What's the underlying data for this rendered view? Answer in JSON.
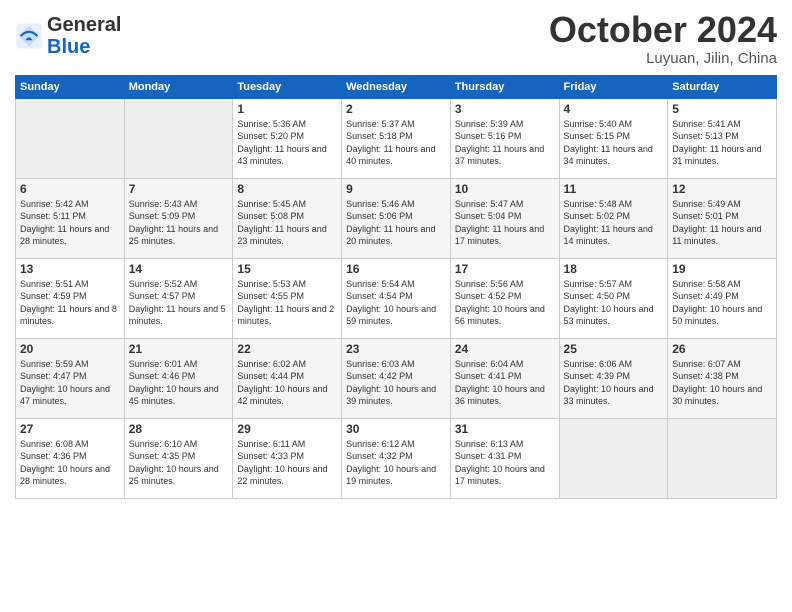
{
  "header": {
    "logo_general": "General",
    "logo_blue": "Blue",
    "month_title": "October 2024",
    "location": "Luyuan, Jilin, China"
  },
  "weekdays": [
    "Sunday",
    "Monday",
    "Tuesday",
    "Wednesday",
    "Thursday",
    "Friday",
    "Saturday"
  ],
  "weeks": [
    [
      {
        "day": "",
        "sunrise": "",
        "sunset": "",
        "daylight": ""
      },
      {
        "day": "",
        "sunrise": "",
        "sunset": "",
        "daylight": ""
      },
      {
        "day": "1",
        "sunrise": "Sunrise: 5:36 AM",
        "sunset": "Sunset: 5:20 PM",
        "daylight": "Daylight: 11 hours and 43 minutes."
      },
      {
        "day": "2",
        "sunrise": "Sunrise: 5:37 AM",
        "sunset": "Sunset: 5:18 PM",
        "daylight": "Daylight: 11 hours and 40 minutes."
      },
      {
        "day": "3",
        "sunrise": "Sunrise: 5:39 AM",
        "sunset": "Sunset: 5:16 PM",
        "daylight": "Daylight: 11 hours and 37 minutes."
      },
      {
        "day": "4",
        "sunrise": "Sunrise: 5:40 AM",
        "sunset": "Sunset: 5:15 PM",
        "daylight": "Daylight: 11 hours and 34 minutes."
      },
      {
        "day": "5",
        "sunrise": "Sunrise: 5:41 AM",
        "sunset": "Sunset: 5:13 PM",
        "daylight": "Daylight: 11 hours and 31 minutes."
      }
    ],
    [
      {
        "day": "6",
        "sunrise": "Sunrise: 5:42 AM",
        "sunset": "Sunset: 5:11 PM",
        "daylight": "Daylight: 11 hours and 28 minutes."
      },
      {
        "day": "7",
        "sunrise": "Sunrise: 5:43 AM",
        "sunset": "Sunset: 5:09 PM",
        "daylight": "Daylight: 11 hours and 25 minutes."
      },
      {
        "day": "8",
        "sunrise": "Sunrise: 5:45 AM",
        "sunset": "Sunset: 5:08 PM",
        "daylight": "Daylight: 11 hours and 23 minutes."
      },
      {
        "day": "9",
        "sunrise": "Sunrise: 5:46 AM",
        "sunset": "Sunset: 5:06 PM",
        "daylight": "Daylight: 11 hours and 20 minutes."
      },
      {
        "day": "10",
        "sunrise": "Sunrise: 5:47 AM",
        "sunset": "Sunset: 5:04 PM",
        "daylight": "Daylight: 11 hours and 17 minutes."
      },
      {
        "day": "11",
        "sunrise": "Sunrise: 5:48 AM",
        "sunset": "Sunset: 5:02 PM",
        "daylight": "Daylight: 11 hours and 14 minutes."
      },
      {
        "day": "12",
        "sunrise": "Sunrise: 5:49 AM",
        "sunset": "Sunset: 5:01 PM",
        "daylight": "Daylight: 11 hours and 11 minutes."
      }
    ],
    [
      {
        "day": "13",
        "sunrise": "Sunrise: 5:51 AM",
        "sunset": "Sunset: 4:59 PM",
        "daylight": "Daylight: 11 hours and 8 minutes."
      },
      {
        "day": "14",
        "sunrise": "Sunrise: 5:52 AM",
        "sunset": "Sunset: 4:57 PM",
        "daylight": "Daylight: 11 hours and 5 minutes."
      },
      {
        "day": "15",
        "sunrise": "Sunrise: 5:53 AM",
        "sunset": "Sunset: 4:55 PM",
        "daylight": "Daylight: 11 hours and 2 minutes."
      },
      {
        "day": "16",
        "sunrise": "Sunrise: 5:54 AM",
        "sunset": "Sunset: 4:54 PM",
        "daylight": "Daylight: 10 hours and 59 minutes."
      },
      {
        "day": "17",
        "sunrise": "Sunrise: 5:56 AM",
        "sunset": "Sunset: 4:52 PM",
        "daylight": "Daylight: 10 hours and 56 minutes."
      },
      {
        "day": "18",
        "sunrise": "Sunrise: 5:57 AM",
        "sunset": "Sunset: 4:50 PM",
        "daylight": "Daylight: 10 hours and 53 minutes."
      },
      {
        "day": "19",
        "sunrise": "Sunrise: 5:58 AM",
        "sunset": "Sunset: 4:49 PM",
        "daylight": "Daylight: 10 hours and 50 minutes."
      }
    ],
    [
      {
        "day": "20",
        "sunrise": "Sunrise: 5:59 AM",
        "sunset": "Sunset: 4:47 PM",
        "daylight": "Daylight: 10 hours and 47 minutes."
      },
      {
        "day": "21",
        "sunrise": "Sunrise: 6:01 AM",
        "sunset": "Sunset: 4:46 PM",
        "daylight": "Daylight: 10 hours and 45 minutes."
      },
      {
        "day": "22",
        "sunrise": "Sunrise: 6:02 AM",
        "sunset": "Sunset: 4:44 PM",
        "daylight": "Daylight: 10 hours and 42 minutes."
      },
      {
        "day": "23",
        "sunrise": "Sunrise: 6:03 AM",
        "sunset": "Sunset: 4:42 PM",
        "daylight": "Daylight: 10 hours and 39 minutes."
      },
      {
        "day": "24",
        "sunrise": "Sunrise: 6:04 AM",
        "sunset": "Sunset: 4:41 PM",
        "daylight": "Daylight: 10 hours and 36 minutes."
      },
      {
        "day": "25",
        "sunrise": "Sunrise: 6:06 AM",
        "sunset": "Sunset: 4:39 PM",
        "daylight": "Daylight: 10 hours and 33 minutes."
      },
      {
        "day": "26",
        "sunrise": "Sunrise: 6:07 AM",
        "sunset": "Sunset: 4:38 PM",
        "daylight": "Daylight: 10 hours and 30 minutes."
      }
    ],
    [
      {
        "day": "27",
        "sunrise": "Sunrise: 6:08 AM",
        "sunset": "Sunset: 4:36 PM",
        "daylight": "Daylight: 10 hours and 28 minutes."
      },
      {
        "day": "28",
        "sunrise": "Sunrise: 6:10 AM",
        "sunset": "Sunset: 4:35 PM",
        "daylight": "Daylight: 10 hours and 25 minutes."
      },
      {
        "day": "29",
        "sunrise": "Sunrise: 6:11 AM",
        "sunset": "Sunset: 4:33 PM",
        "daylight": "Daylight: 10 hours and 22 minutes."
      },
      {
        "day": "30",
        "sunrise": "Sunrise: 6:12 AM",
        "sunset": "Sunset: 4:32 PM",
        "daylight": "Daylight: 10 hours and 19 minutes."
      },
      {
        "day": "31",
        "sunrise": "Sunrise: 6:13 AM",
        "sunset": "Sunset: 4:31 PM",
        "daylight": "Daylight: 10 hours and 17 minutes."
      },
      {
        "day": "",
        "sunrise": "",
        "sunset": "",
        "daylight": ""
      },
      {
        "day": "",
        "sunrise": "",
        "sunset": "",
        "daylight": ""
      }
    ]
  ]
}
